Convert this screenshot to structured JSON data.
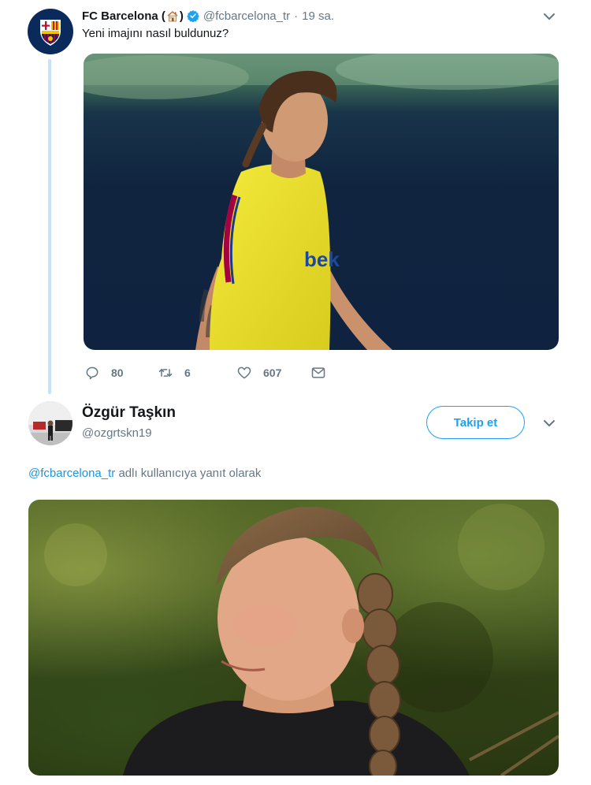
{
  "tweet": {
    "display_name": "FC Barcelona (",
    "display_name_suffix": ")",
    "verified_icon": "verified-badge-icon",
    "handle": "@fcbarcelona_tr",
    "separator": "·",
    "time": "19 sa.",
    "text": "Yeni imajını nasıl buldunuz?",
    "media_description": "player-photo",
    "actions": {
      "reply_count": "80",
      "retweet_count": "6",
      "like_count": "607"
    }
  },
  "reply": {
    "display_name": "Özgür Taşkın",
    "handle": "@ozgrtskn19",
    "follow_label": "Takip et",
    "context_mention": "@fcbarcelona_tr",
    "context_text": " adlı kullanıcıya yanıt olarak",
    "media_description": "woman-photo"
  },
  "colors": {
    "accent": "#1da1f2",
    "muted": "#657786",
    "text": "#14171a",
    "thread_line": "#c4e3f7"
  },
  "icons": [
    "house-emoji-icon",
    "verified-badge-icon",
    "chevron-down-icon",
    "reply-icon",
    "retweet-icon",
    "like-icon",
    "dm-icon",
    "fc-barcelona-crest-icon"
  ]
}
